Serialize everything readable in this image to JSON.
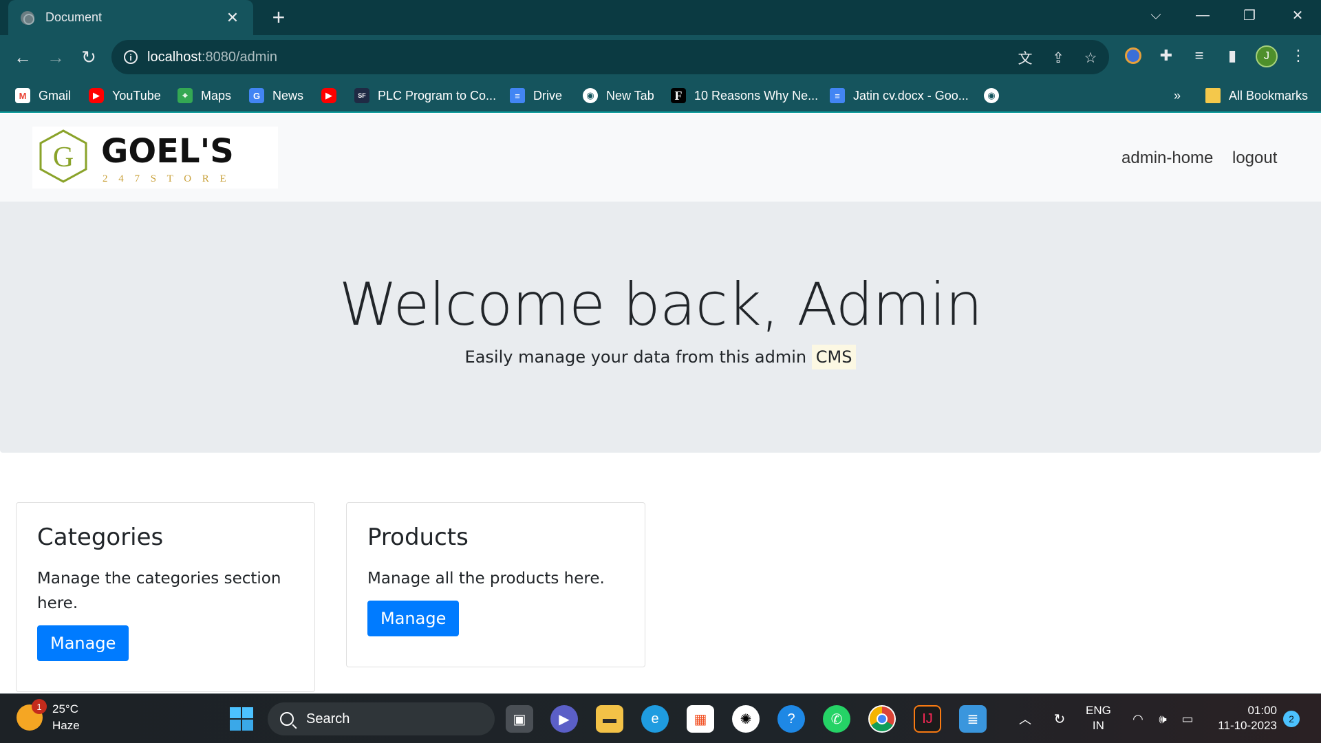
{
  "browser": {
    "tab_title": "Document",
    "tab_close": "✕",
    "new_tab": "+",
    "url_host": "localhost",
    "url_rest": ":8080/admin",
    "window_controls": {
      "minimize": "—",
      "restore": "❐",
      "close": "✕",
      "tab_search": "⌵"
    },
    "nav": {
      "back": "←",
      "forward": "→",
      "reload": "↻"
    },
    "profile_initial": "J",
    "bookmarks": [
      {
        "label": "Gmail",
        "icon": "M"
      },
      {
        "label": "YouTube",
        "icon": "▶"
      },
      {
        "label": "Maps",
        "icon": "⌖"
      },
      {
        "label": "News",
        "icon": "G"
      },
      {
        "label": "",
        "icon": "▶"
      },
      {
        "label": "PLC Program to Co...",
        "icon": "SF"
      },
      {
        "label": "Drive",
        "icon": "≡"
      },
      {
        "label": "New Tab",
        "icon": "◉"
      },
      {
        "label": "10 Reasons Why Ne...",
        "icon": "F"
      },
      {
        "label": "Jatin cv.docx - Goo...",
        "icon": "≡"
      },
      {
        "label": "",
        "icon": "◉"
      }
    ],
    "bookmarks_overflow": "»",
    "all_bookmarks": "All Bookmarks"
  },
  "site": {
    "logo_text": "GOEL'S",
    "logo_sub": "2 4   7   S T O R E",
    "nav_links": [
      "admin-home",
      "logout"
    ]
  },
  "hero": {
    "title": "Welcome back, Admin",
    "lead": "Easily manage your data from this admin",
    "lead_mark": "CMS"
  },
  "cards": [
    {
      "title": "Categories",
      "text": "Manage the categories section here.",
      "button": "Manage"
    },
    {
      "title": "Products",
      "text": "Manage all the products here.",
      "button": "Manage"
    }
  ],
  "taskbar": {
    "weather_temp": "25°C",
    "weather_desc": "Haze",
    "weather_badge": "1",
    "search_label": "Search",
    "lang_top": "ENG",
    "lang_bottom": "IN",
    "time": "01:00",
    "date": "11-10-2023",
    "notifications": "2"
  },
  "colors": {
    "browser_frame": "#0b3a42",
    "browser_toolbar": "#15545d",
    "primary_button": "#007bff",
    "jumbotron_bg": "#e9ecef",
    "navbar_bg": "#f8f9fa"
  }
}
